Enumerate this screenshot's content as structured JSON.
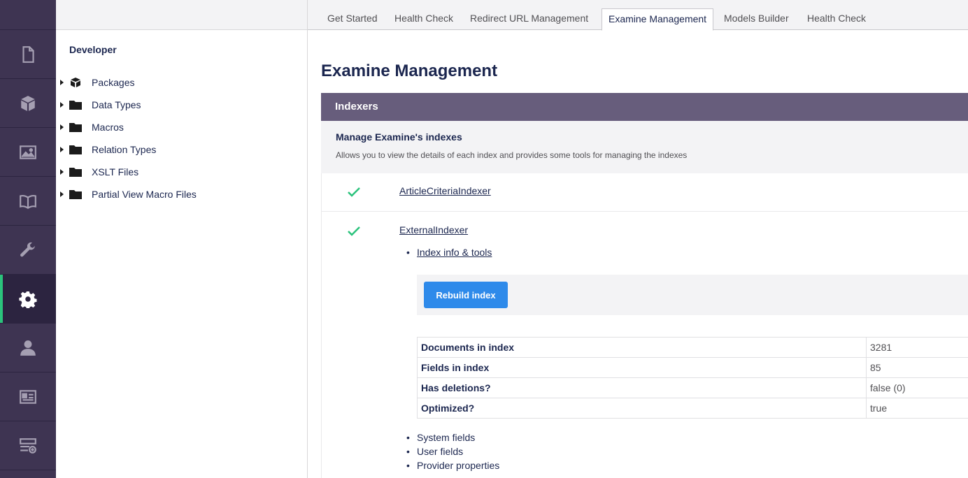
{
  "rail": {
    "items": [
      {
        "name": "content",
        "icon": "document-icon"
      },
      {
        "name": "packages",
        "icon": "package-icon"
      },
      {
        "name": "media",
        "icon": "image-icon"
      },
      {
        "name": "translation",
        "icon": "book-icon"
      },
      {
        "name": "settings",
        "icon": "wrench-icon"
      },
      {
        "name": "developer",
        "icon": "gear-icon",
        "active": true
      },
      {
        "name": "users",
        "icon": "user-icon"
      },
      {
        "name": "members",
        "icon": "id-card-icon"
      },
      {
        "name": "forms",
        "icon": "form-add-icon"
      }
    ],
    "active_accent": "#2bc37c"
  },
  "tree": {
    "title": "Developer",
    "items": [
      {
        "label": "Packages",
        "icon": "package-icon"
      },
      {
        "label": "Data Types",
        "icon": "folder-icon"
      },
      {
        "label": "Macros",
        "icon": "folder-icon"
      },
      {
        "label": "Relation Types",
        "icon": "folder-icon"
      },
      {
        "label": "XSLT Files",
        "icon": "folder-icon"
      },
      {
        "label": "Partial View Macro Files",
        "icon": "folder-icon"
      }
    ]
  },
  "tabs": [
    {
      "label": "Get Started"
    },
    {
      "label": "Health Check"
    },
    {
      "label": "Redirect URL Management"
    },
    {
      "label": "Examine Management",
      "active": true
    },
    {
      "label": "Models Builder"
    },
    {
      "label": "Health Check"
    }
  ],
  "main": {
    "title": "Examine Management",
    "panel_title": "Indexers",
    "panel_sub_title": "Manage Examine's indexes",
    "panel_sub_desc": "Allows you to view the details of each index and provides some tools for managing the indexes",
    "indexers": [
      {
        "name": "ArticleCriteriaIndexer",
        "status": "healthy"
      },
      {
        "name": "ExternalIndexer",
        "status": "healthy"
      }
    ],
    "index_info_link": "Index info & tools",
    "rebuild_label": "Rebuild index",
    "info_rows": [
      {
        "key": "Documents in index",
        "value": "3281"
      },
      {
        "key": "Fields in index",
        "value": "85"
      },
      {
        "key": "Has deletions?",
        "value": "false (0)"
      },
      {
        "key": "Optimized?",
        "value": "true"
      }
    ],
    "more_items": [
      "System fields",
      "User fields",
      "Provider properties"
    ],
    "colors": {
      "panel_header": "#675d7c",
      "button": "#2e8aea",
      "check": "#2bc37c"
    }
  }
}
